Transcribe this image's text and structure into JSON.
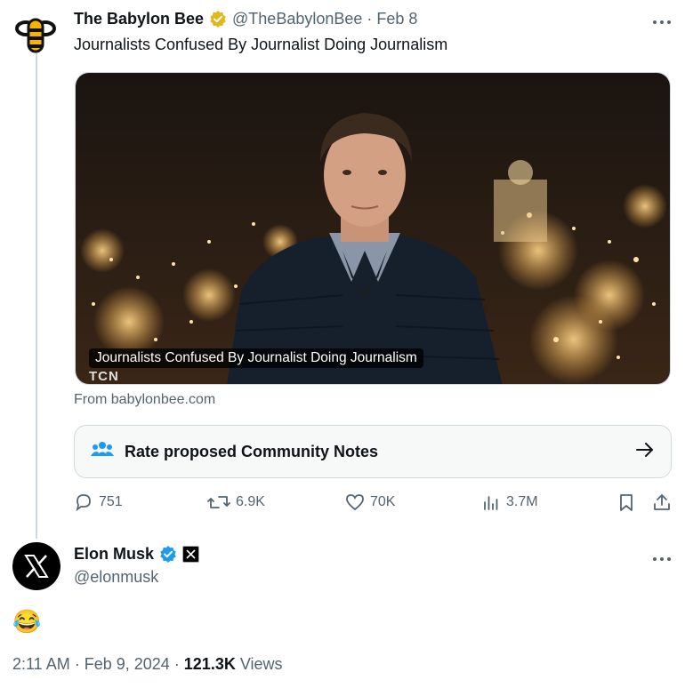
{
  "tweet1": {
    "display_name": "The Babylon Bee",
    "handle": "@TheBabylonBee",
    "date": "· Feb 8",
    "text": "Journalists Confused By Journalist Doing Journalism",
    "card": {
      "caption": "Journalists Confused By Journalist Doing Journalism",
      "watermark": "TCN",
      "source": "From babylonbee.com"
    },
    "community_notes": {
      "label": "Rate proposed Community Notes",
      "icon": "people-icon"
    },
    "actions": {
      "replies": "751",
      "reposts": "6.9K",
      "likes": "70K",
      "views": "3.7M"
    }
  },
  "tweet2": {
    "display_name": "Elon Musk",
    "handle": "@elonmusk",
    "text": "😂",
    "time": "2:11 AM · Feb 9, 2024 · ",
    "views_count": "121.3K",
    "views_label": " Views"
  },
  "colors": {
    "text": "#0f1419",
    "muted": "#536471",
    "gold_badge": "#e2b719",
    "blue_badge": "#1d9bf0",
    "border": "#cfd9de"
  }
}
